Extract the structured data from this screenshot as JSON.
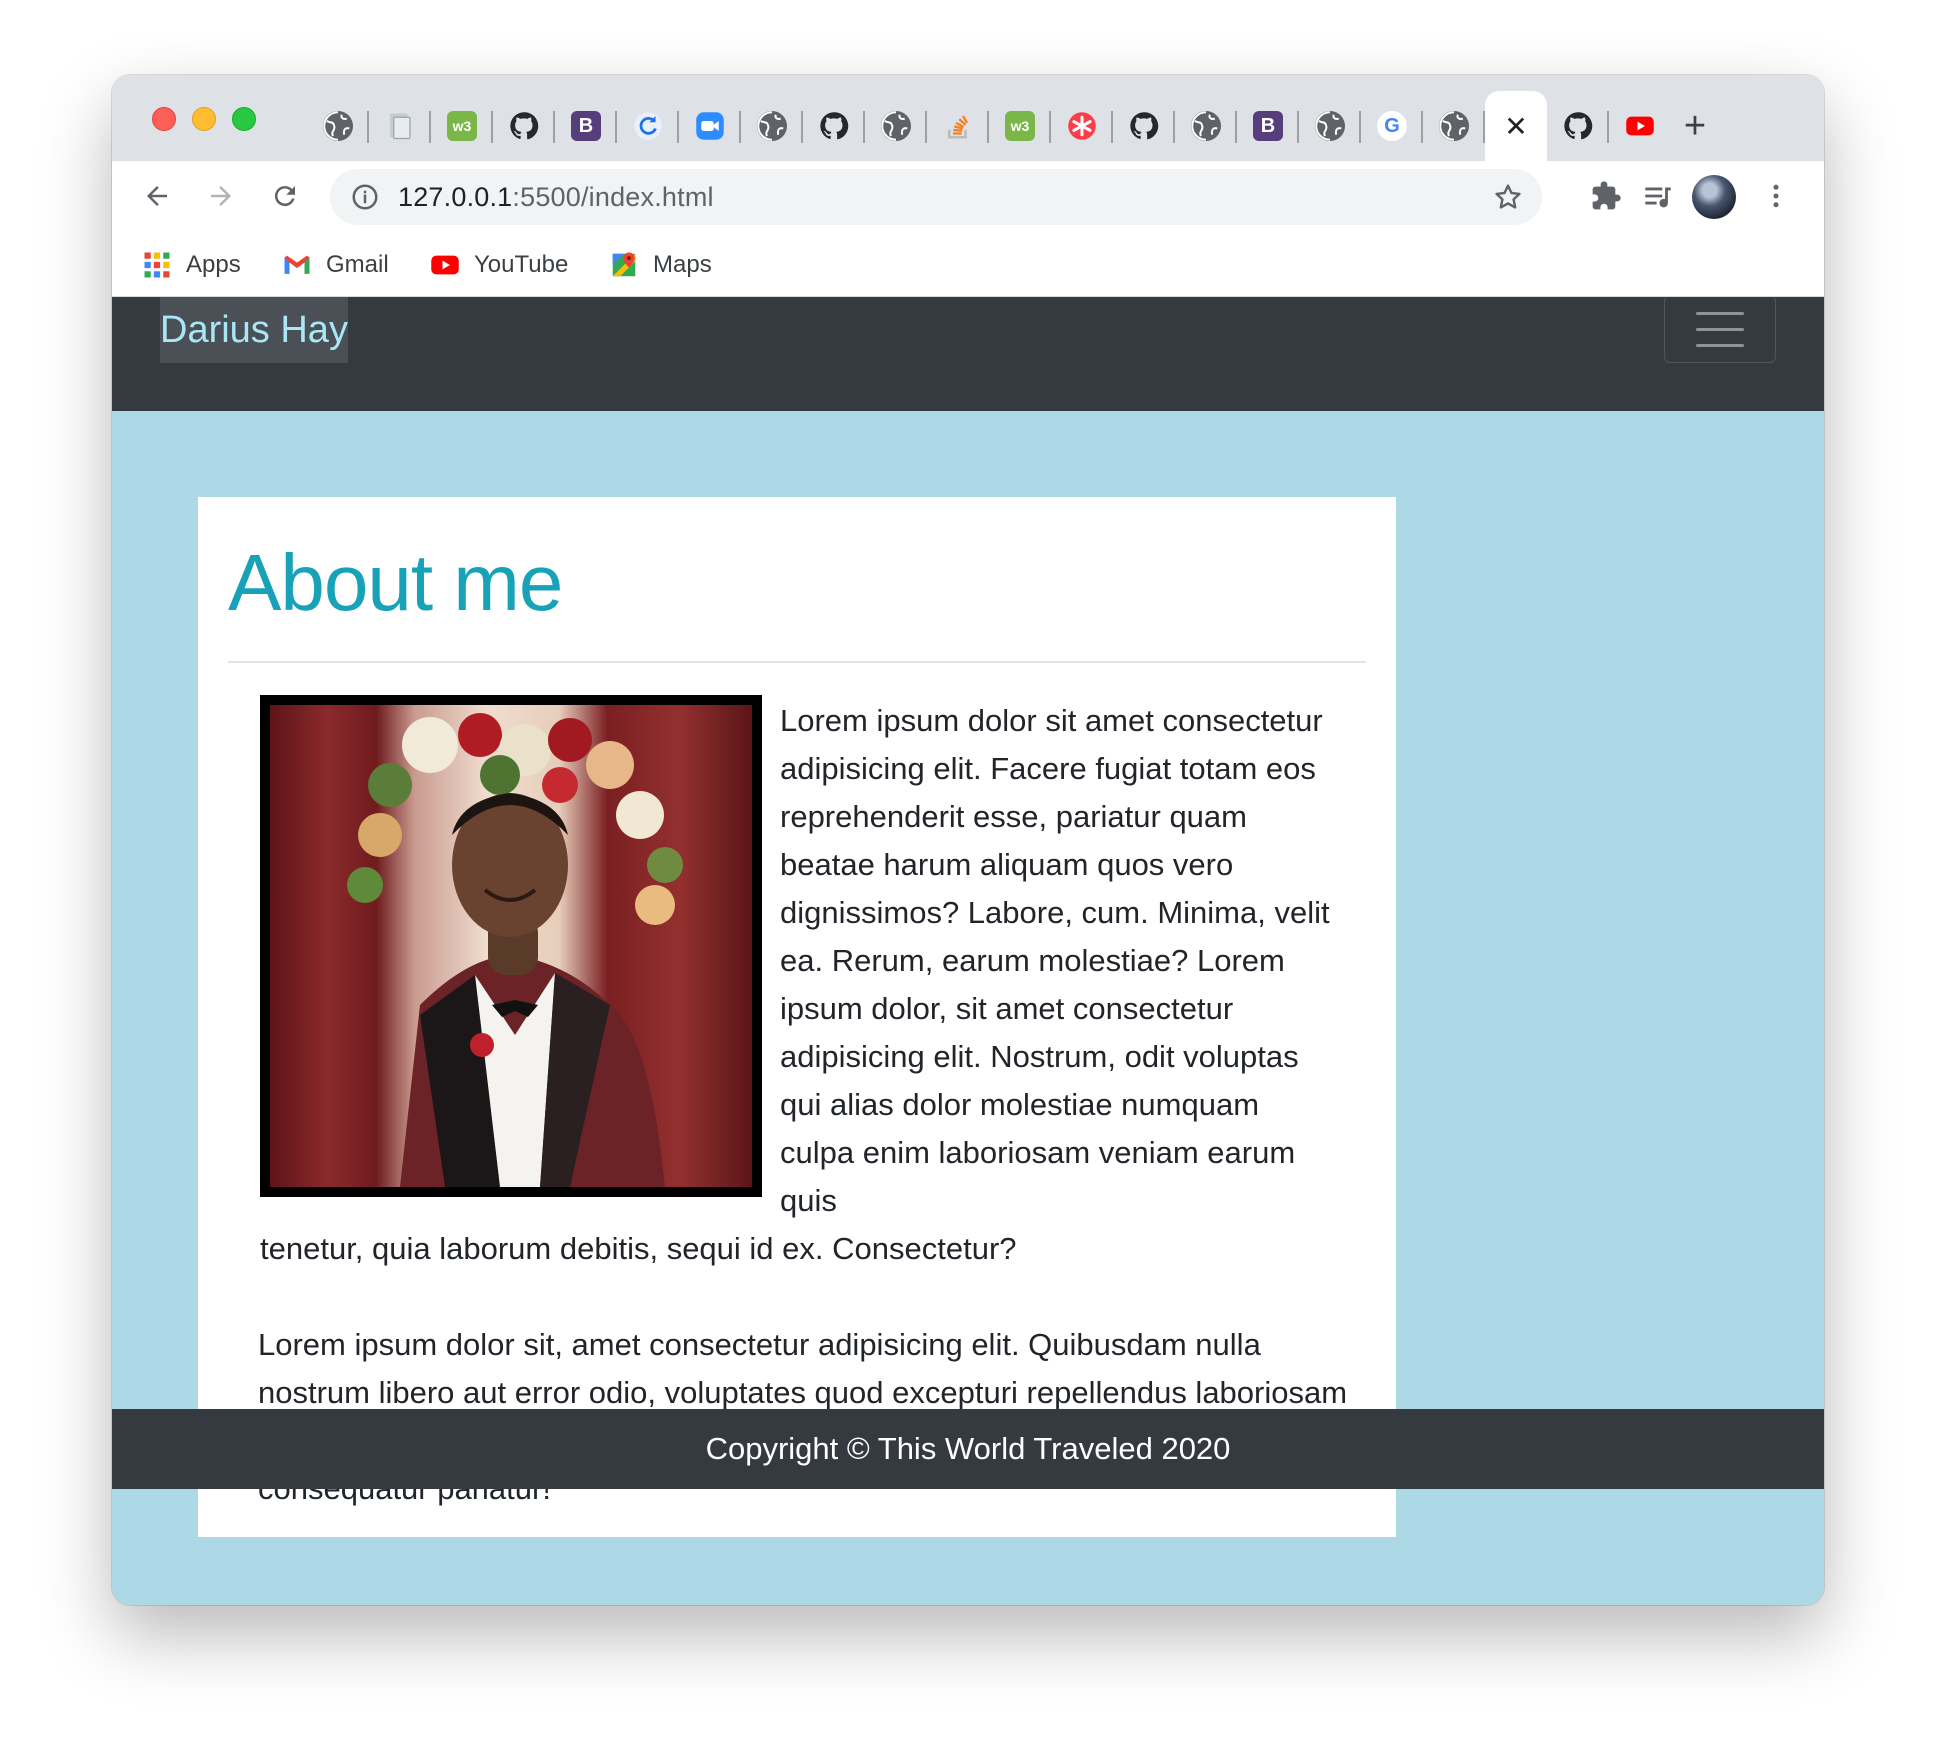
{
  "browser": {
    "tabs": [
      {
        "icon": "globe-icon"
      },
      {
        "icon": "document-icon"
      },
      {
        "icon": "w3schools-icon",
        "text": "w3"
      },
      {
        "icon": "github-icon"
      },
      {
        "icon": "bootstrap-icon",
        "text": "B"
      },
      {
        "icon": "sync-icon"
      },
      {
        "icon": "zoom-icon"
      },
      {
        "icon": "globe-icon"
      },
      {
        "icon": "github-icon"
      },
      {
        "icon": "globe-icon"
      },
      {
        "icon": "stackoverflow-icon"
      },
      {
        "icon": "w3schools-icon",
        "text": "w3"
      },
      {
        "icon": "asterisk-icon"
      },
      {
        "icon": "github-icon"
      },
      {
        "icon": "globe-icon"
      },
      {
        "icon": "bootstrap-icon",
        "text": "B"
      },
      {
        "icon": "globe-icon"
      },
      {
        "icon": "google-icon",
        "text": "G"
      },
      {
        "icon": "globe-icon"
      },
      {
        "icon": "close-icon",
        "text": "✕",
        "active": true
      },
      {
        "icon": "github-icon"
      },
      {
        "icon": "youtube-icon"
      }
    ],
    "new_tab_label": "+",
    "url_host": "127.0.0.1",
    "url_path": ":5500/index.html",
    "bookmarks": [
      {
        "label": "Apps",
        "icon": "apps-grid-icon"
      },
      {
        "label": "Gmail",
        "icon": "gmail-icon"
      },
      {
        "label": "YouTube",
        "icon": "youtube-icon"
      },
      {
        "label": "Maps",
        "icon": "maps-icon"
      }
    ]
  },
  "site": {
    "brand": "Darius Hay",
    "heading": "About me",
    "paragraph1_wrapped": " Lorem ipsum dolor sit amet consectetur adipisicing elit. Facere fugiat totam eos reprehenderit esse, pariatur quam beatae harum aliquam quos vero dignissimos? Labore, cum. Minima, velit ea. Rerum, earum molestiae? Lorem ipsum dolor, sit amet consectetur adipisicing elit. Nostrum, odit voluptas qui alias dolor molestiae numquam culpa enim laboriosam veniam earum quis",
    "paragraph1_tail": "tenetur, quia laborum debitis, sequi id ex. Consectetur?",
    "paragraph2": "Lorem ipsum dolor sit, amet consectetur adipisicing elit. Quibusdam nulla nostrum libero aut error odio, voluptates quod excepturi repellendus laboriosam eligendi, sed cumque voluptate unde debitis necessitatibus deleniti consequatur pariatur!",
    "footer": "Copyright © This World Traveled 2020"
  },
  "colors": {
    "page_background": "#add8e6",
    "navbar": "#343a40",
    "heading": "#17a2b8",
    "brand_text": "#a9e6f6"
  }
}
